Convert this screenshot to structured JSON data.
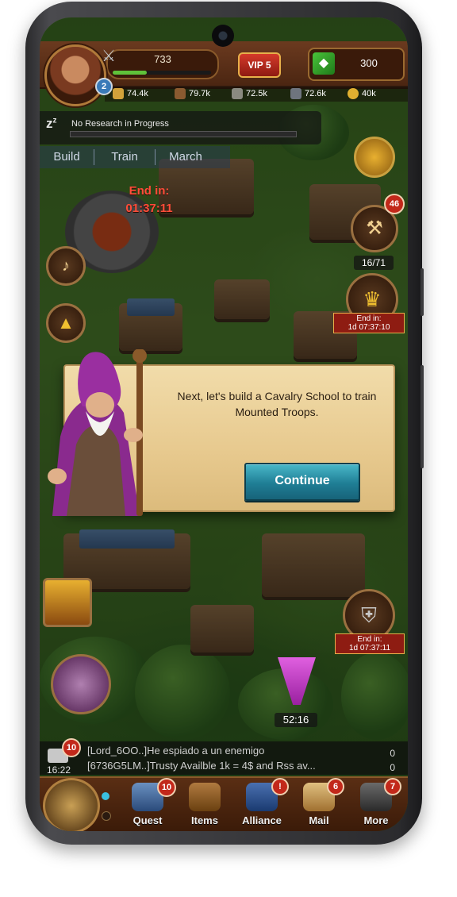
{
  "header": {
    "power": "733",
    "power_progress": 0.35,
    "player_level": "2",
    "vip": "VIP 5",
    "gems": "300",
    "resources": [
      "74.4k",
      "79.7k",
      "72.5k",
      "72.6k",
      "40k"
    ]
  },
  "research": {
    "status": "No Research in Progress"
  },
  "tabs": [
    "Build",
    "Train",
    "March"
  ],
  "timers": {
    "forge_label": "End in:",
    "forge_time": "01:37:11",
    "crown_end": "End in:",
    "crown_time": "1d 07:37:10",
    "knight_end": "End in:",
    "knight_time": "1d 07:37:11",
    "drill_time": "52:16"
  },
  "badges": {
    "builder_count": "46",
    "troops_count": "16/71",
    "chat_unread": "10",
    "quest": "10",
    "alliance": "!",
    "mail": "6",
    "more": "7"
  },
  "dialog": {
    "message": "Next, let's build a Cavalry School to train Mounted Troops.",
    "continue_label": "Continue"
  },
  "chat": {
    "time": "16:22",
    "line1": "[Lord_6OO..]He espiado a un enemigo",
    "line2": "[6736G5LM..]Trusty Availble 1k = 4$ and Rss av...",
    "count1": "0",
    "count2": "0"
  },
  "nav": {
    "quest": "Quest",
    "items": "Items",
    "alliance": "Alliance",
    "mail": "Mail",
    "more": "More"
  }
}
